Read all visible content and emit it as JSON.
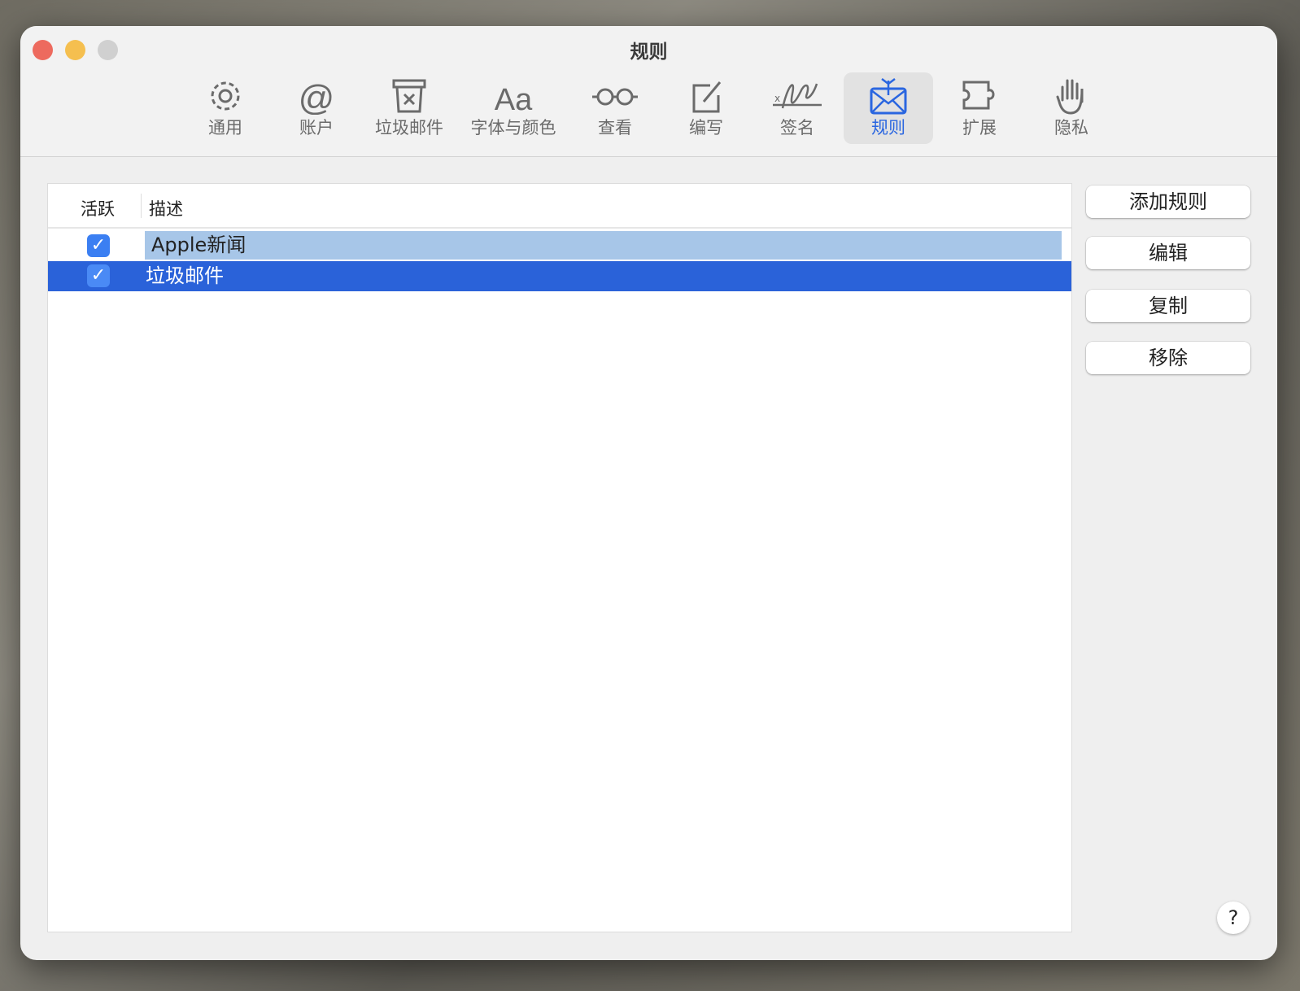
{
  "window": {
    "title": "规则"
  },
  "toolbar": {
    "items": [
      {
        "label": "通用",
        "icon": "gear-icon"
      },
      {
        "label": "账户",
        "icon": "at-icon"
      },
      {
        "label": "垃圾邮件",
        "icon": "junk-bin-icon"
      },
      {
        "label": "字体与颜色",
        "icon": "font-icon"
      },
      {
        "label": "查看",
        "icon": "glasses-icon"
      },
      {
        "label": "编写",
        "icon": "compose-icon"
      },
      {
        "label": "签名",
        "icon": "signature-icon"
      },
      {
        "label": "规则",
        "icon": "rules-envelope-icon",
        "selected": true
      },
      {
        "label": "扩展",
        "icon": "puzzle-icon"
      },
      {
        "label": "隐私",
        "icon": "hand-icon"
      }
    ]
  },
  "table": {
    "headers": {
      "active": "活跃",
      "description": "描述"
    },
    "rows": [
      {
        "active": true,
        "description": "Apple新闻"
      },
      {
        "active": true,
        "description": "垃圾邮件"
      }
    ]
  },
  "buttons": {
    "add": "添加规则",
    "edit": "编辑",
    "duplicate": "复制",
    "remove": "移除",
    "help": "?"
  },
  "colors": {
    "accent": "#2a66e0",
    "selection": "#2a62d9",
    "inactive_selection": "#a7c6e8"
  }
}
